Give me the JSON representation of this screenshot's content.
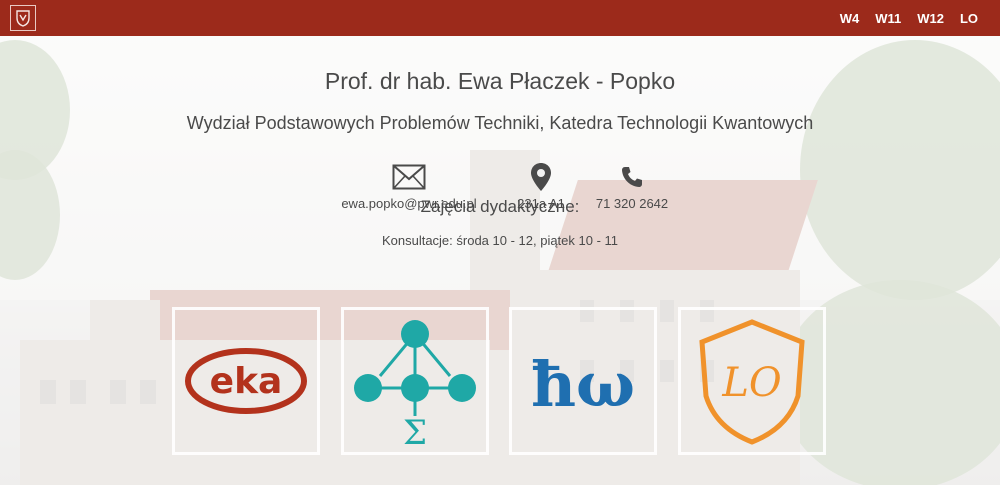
{
  "nav": {
    "items": [
      "W4",
      "W11",
      "W12",
      "LO"
    ]
  },
  "profile": {
    "name": "Prof. dr hab. Ewa Płaczek - Popko",
    "department": "Wydział Podstawowych Problemów Techniki, Katedra Technologii Kwantowych"
  },
  "contacts": {
    "email": "ewa.popko@pwr.edu.pl",
    "room": "231a A1",
    "phone": "71 320 2642"
  },
  "teaching": {
    "heading": "Zajęcia dydaktyczne:",
    "consultations": "Konsultacje: środa 10 - 12, piątek 10 - 11"
  },
  "tiles": {
    "eka_text": "eka",
    "hw_text": "ħω",
    "lo_text": "LO",
    "sigma_text": "Σ"
  },
  "colors": {
    "topbar": "#9c2a1b",
    "eka": "#b3321c",
    "sigma": "#1fa8a6",
    "hw": "#1f6fb0",
    "lo": "#f0922b"
  }
}
